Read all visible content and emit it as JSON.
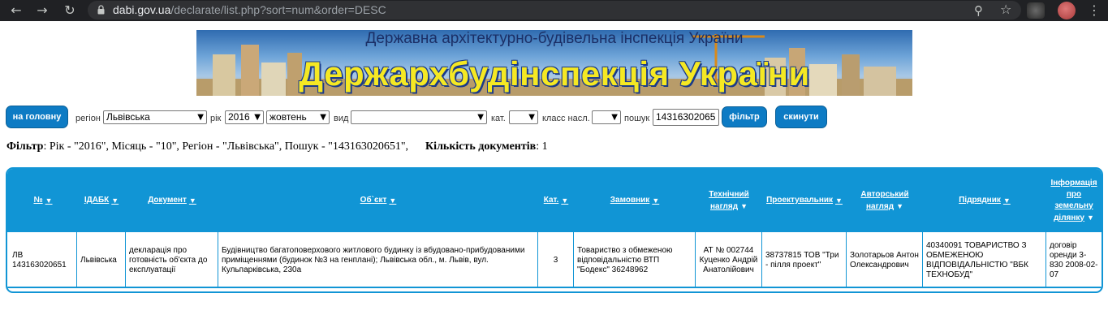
{
  "browser": {
    "url_host": "dabi.gov.ua",
    "url_path": "/declarate/list.php?sort=num&order=DESC",
    "back_icon": "arrow-left",
    "forward_icon": "arrow-right",
    "reload_icon": "reload",
    "zoom_icon": "magnifier",
    "star_icon": "star"
  },
  "banner": {
    "top_text": "Державна архітектурно-будівельна інспекція України",
    "main_text": "Держархбудінспекція України",
    "text_color": "#f5e823"
  },
  "filter_bar": {
    "home_button": "на головну",
    "region_label": "регіон",
    "region_value": "Львівська",
    "year_label": "рік",
    "year_value": "2016",
    "month_value": "жовтень",
    "kind_label": "вид",
    "kind_value": "",
    "cat_label": "кат.",
    "cat_value": "",
    "class_label": "класс насл.",
    "class_value": "",
    "search_label": "пошук",
    "search_value": "14316302065",
    "filter_button": "фільтр",
    "reset_button": "скинути",
    "button_color": "#0d7bc4"
  },
  "summary": {
    "filter_label": "Фільтр",
    "filter_text": ": Рік - \"2016\", Місяць - \"10\", Регіон - \"Львівська\", Пошук - \"143163020651\",",
    "count_label": "Кількість документів",
    "count_text": ": 1"
  },
  "table": {
    "header_color": "#1195d5",
    "headers": {
      "num": "№",
      "idabk": "ІДАБК",
      "document": "Документ",
      "object": "Об`єкт",
      "cat": "Кат.",
      "customer": "Замовник",
      "tech_l1": "Технічний",
      "tech_l2": "нагляд",
      "designer": "Проектувальник",
      "author_l1": "Авторський",
      "author_l2": "нагляд",
      "contractor": "Підрядник",
      "land_l1": "Інформація",
      "land_l2": "про",
      "land_l3": "земельну",
      "land_l4": "ділянку"
    },
    "row": {
      "num": "ЛВ 143163020651",
      "idabk": "Львівська",
      "document": "декларація про готовність об'єкта до експлуатації",
      "object": "Будівництво багатоповерхового житлового будинку із вбудовано-прибудованими приміщеннями (будинок №3 на генплані); Львівська обл., м. Львів, вул. Кульпарківська, 230а",
      "cat": "3",
      "customer": "Товариство з обмеженою відповідальністю ВТП \"Бодекс\" 36248962",
      "tech": "АТ № 002744 Куценко Андрій Анатолійович",
      "designer": "38737815 ТОВ \"Три - пілля проект\"",
      "author": "Золотарьов Антон Олександрович",
      "contractor": "40340091 ТОВАРИСТВО З ОБМЕЖЕНОЮ ВІДПОВІДАЛЬНІСТЮ \"ВБК ТЕХНОБУД\"",
      "land": "договір оренди 3-830 2008-02-07"
    }
  }
}
